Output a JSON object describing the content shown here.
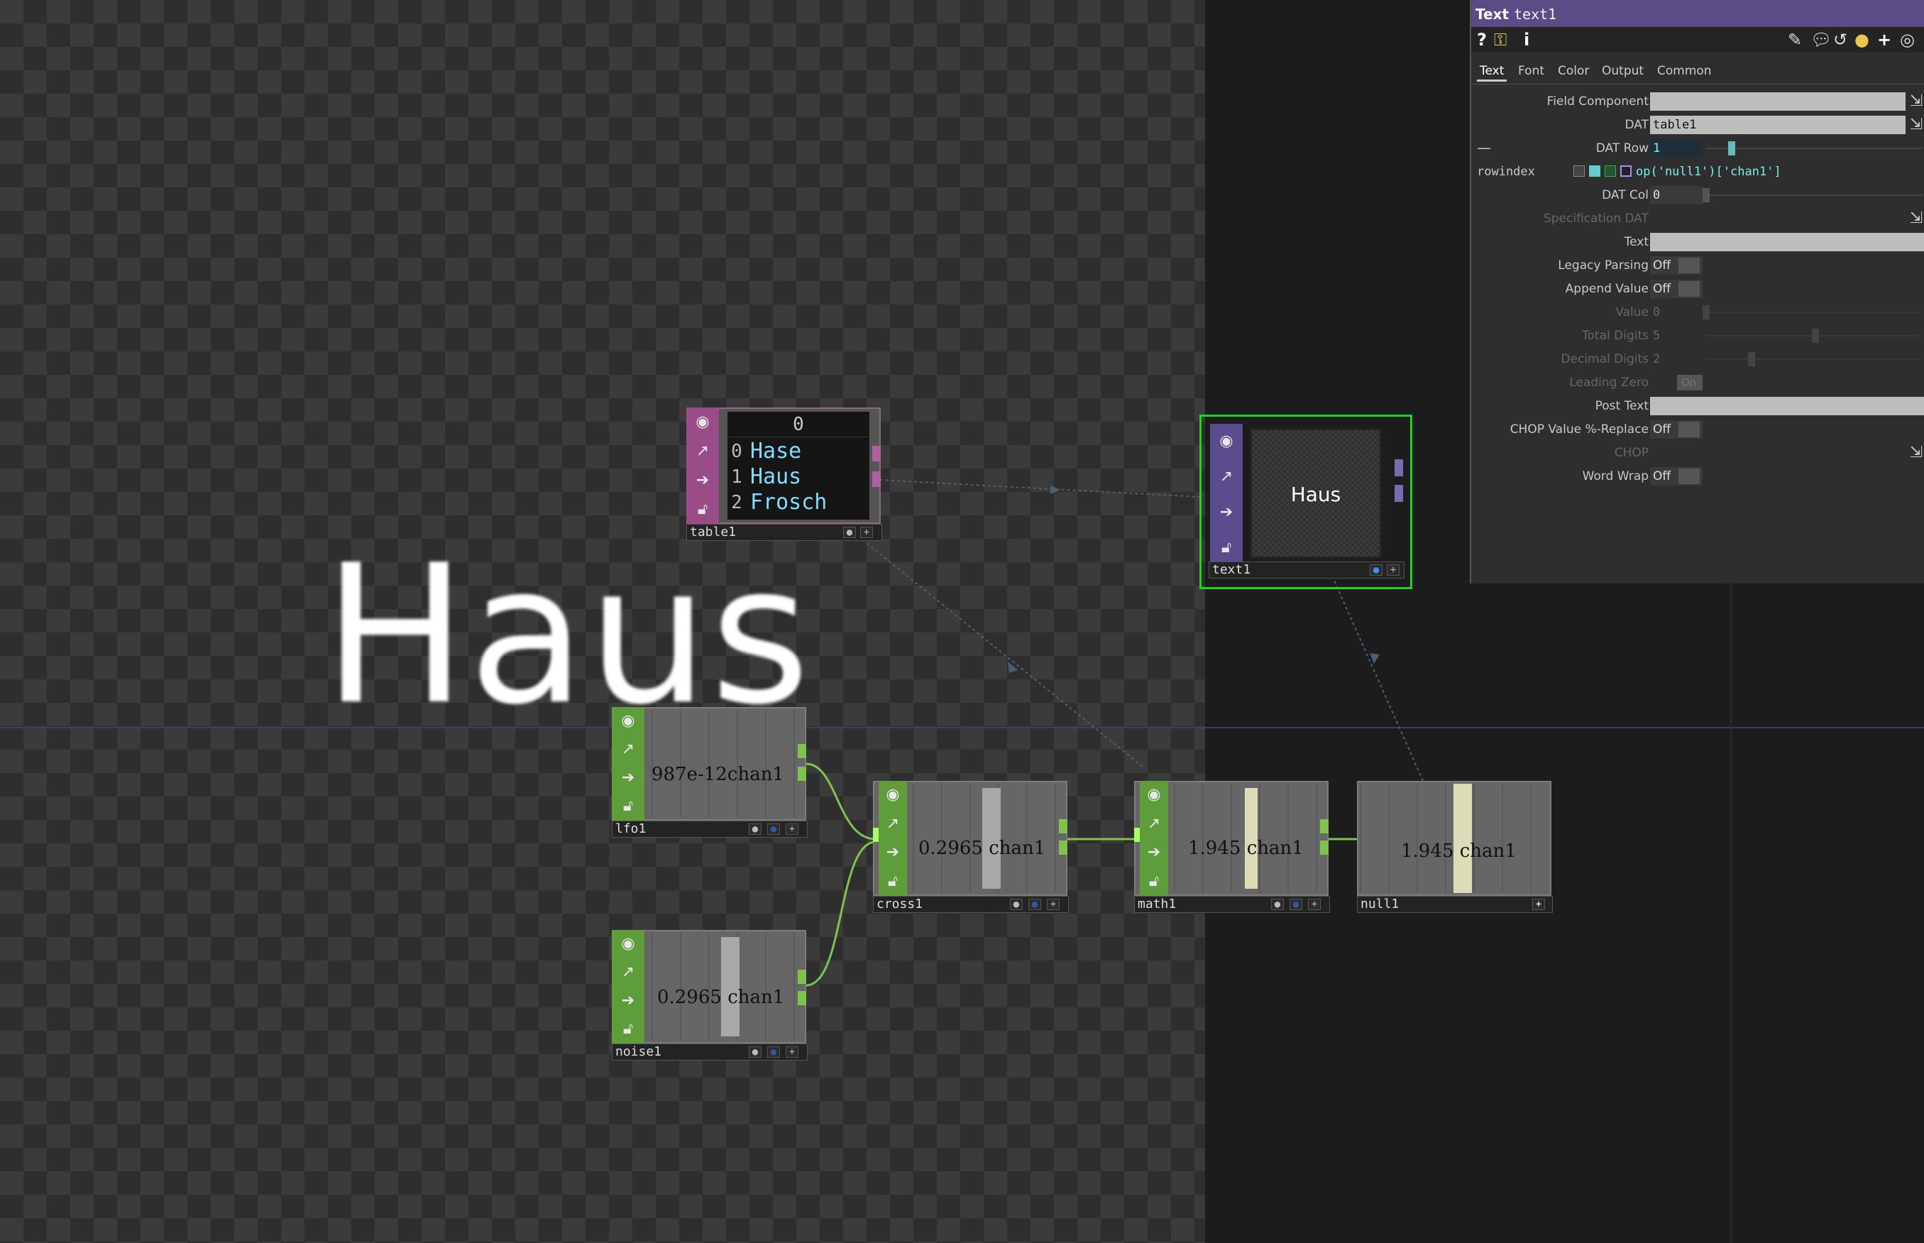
{
  "canvas": {
    "big_text": "Haus"
  },
  "nodes": {
    "table1": {
      "name": "table1",
      "header": "0",
      "rows": [
        {
          "index": "0",
          "value": "Hase"
        },
        {
          "index": "1",
          "value": "Haus"
        },
        {
          "index": "2",
          "value": "Frosch"
        }
      ]
    },
    "text1": {
      "name": "text1",
      "display": "Haus"
    },
    "lfo1": {
      "name": "lfo1",
      "value": "987e-12chan1"
    },
    "noise1": {
      "name": "noise1",
      "value": "0.2965 chan1"
    },
    "cross1": {
      "name": "cross1",
      "value": "0.2965 chan1"
    },
    "math1": {
      "name": "math1",
      "value": "1.945 chan1"
    },
    "null1": {
      "name": "null1",
      "value": "1.945 chan1"
    }
  },
  "panel": {
    "type": "Text",
    "name": "text1",
    "toolbar_icons": [
      "help-icon",
      "python-help-icon",
      "info-icon",
      "edit-icon",
      "comment-icon",
      "undo-icon",
      "python-icon",
      "plus-icon",
      "target-icon"
    ],
    "tabs": [
      "Text",
      "Font",
      "Color",
      "Output",
      "Common"
    ],
    "active_tab": "Text",
    "params": {
      "field_component": {
        "label": "Field Component"
      },
      "dat": {
        "label": "DAT",
        "value": "table1"
      },
      "dat_row": {
        "label": "DAT Row",
        "value": "1"
      },
      "rowindex": {
        "label": "rowindex",
        "expression": "op('null1')['chan1']"
      },
      "dat_col": {
        "label": "DAT Col",
        "value": "0"
      },
      "specification_dat": {
        "label": "Specification DAT"
      },
      "text": {
        "label": "Text"
      },
      "legacy_parsing": {
        "label": "Legacy Parsing",
        "value": "Off"
      },
      "append_value": {
        "label": "Append Value",
        "value": "Off"
      },
      "value": {
        "label": "Value",
        "value": "0"
      },
      "total_digits": {
        "label": "Total Digits",
        "value": "5"
      },
      "decimal_digits": {
        "label": "Decimal Digits",
        "value": "2"
      },
      "leading_zero": {
        "label": "Leading Zero",
        "value": "On"
      },
      "post_text": {
        "label": "Post Text"
      },
      "chop_value_replace": {
        "label": "CHOP Value %-Replace",
        "value": "Off"
      },
      "chop": {
        "label": "CHOP"
      },
      "word_wrap": {
        "label": "Word Wrap",
        "value": "Off"
      }
    }
  }
}
